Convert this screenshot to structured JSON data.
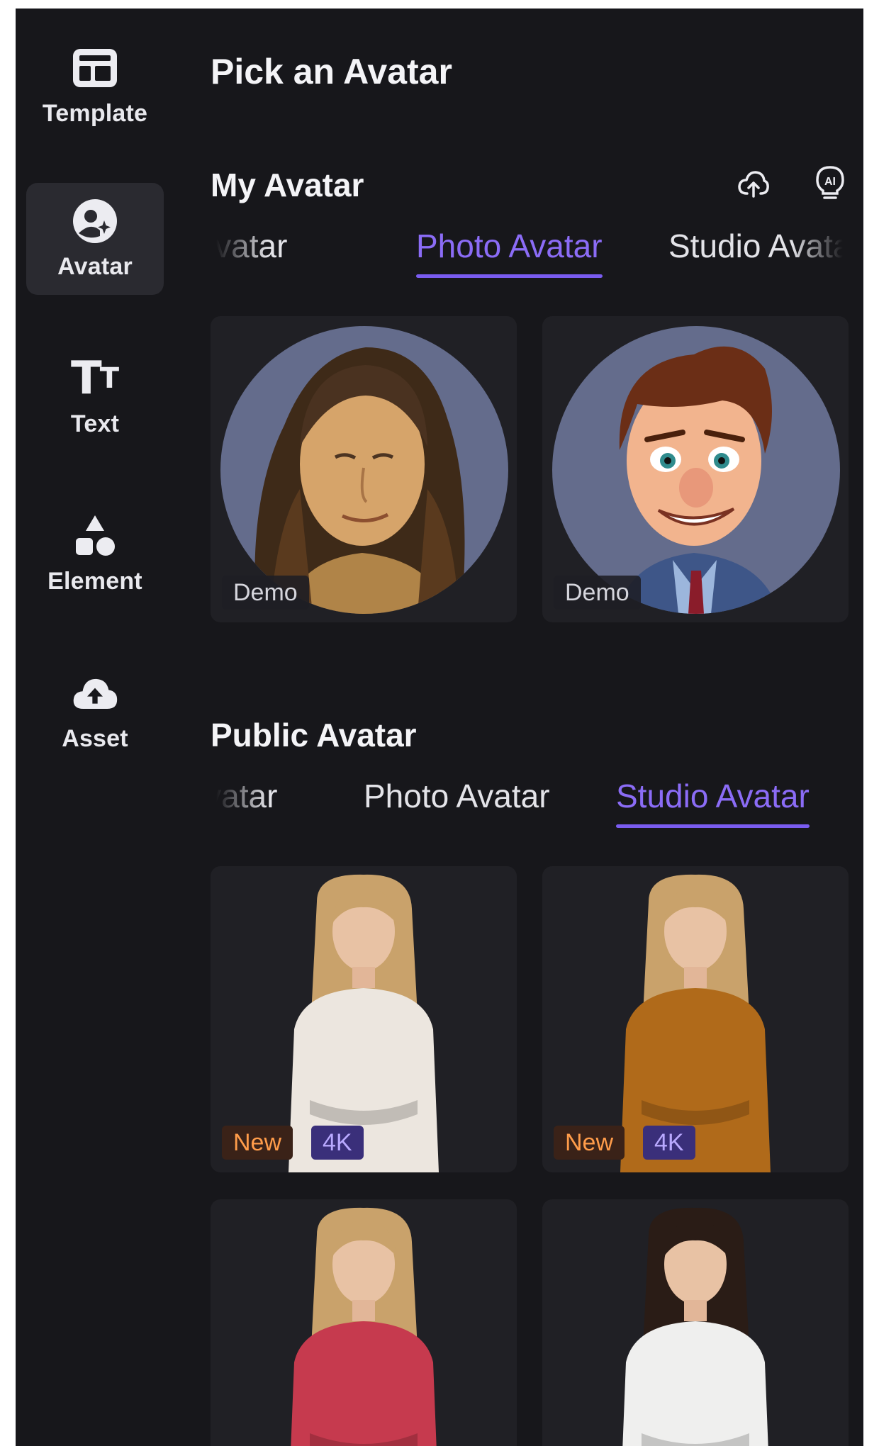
{
  "sidebar": {
    "items": [
      {
        "label": "Template",
        "icon": "template-icon",
        "active": false
      },
      {
        "label": "Avatar",
        "icon": "avatar-icon",
        "active": true
      },
      {
        "label": "Text",
        "icon": "text-icon",
        "active": false
      },
      {
        "label": "Element",
        "icon": "element-icon",
        "active": false
      },
      {
        "label": "Asset",
        "icon": "asset-icon",
        "active": false
      }
    ]
  },
  "main": {
    "title": "Pick an Avatar",
    "my_avatar": {
      "heading": "My Avatar",
      "actions": [
        "upload-cloud-icon",
        "ai-bulb-icon"
      ],
      "tabs": [
        {
          "label": "Instant Avatar",
          "active": false
        },
        {
          "label": "Photo Avatar",
          "active": true
        },
        {
          "label": "Studio Avatar",
          "active": false
        }
      ],
      "cards": [
        {
          "badge": "Demo",
          "subject": "painted-portrait"
        },
        {
          "badge": "Demo",
          "subject": "cartoon-man"
        }
      ]
    },
    "public_avatar": {
      "heading": "Public Avatar",
      "tabs": [
        {
          "label": "Instant Avatar",
          "active": false
        },
        {
          "label": "Photo Avatar",
          "active": false
        },
        {
          "label": "Studio Avatar",
          "active": true
        }
      ],
      "cards": [
        {
          "badges": [
            "New",
            "4K"
          ],
          "outfit_color": "#ece6df"
        },
        {
          "badges": [
            "New",
            "4K"
          ],
          "outfit_color": "#b06a1a"
        },
        {
          "badges": [],
          "outfit_color": "#c63a4e"
        },
        {
          "badges": [],
          "outfit_color": "#efefee"
        }
      ]
    }
  },
  "colors": {
    "background": "#17171b",
    "accent": "#7a5cf0",
    "new_badge_text": "#ff9c4a",
    "k4_badge_text": "#b9a9ff"
  }
}
